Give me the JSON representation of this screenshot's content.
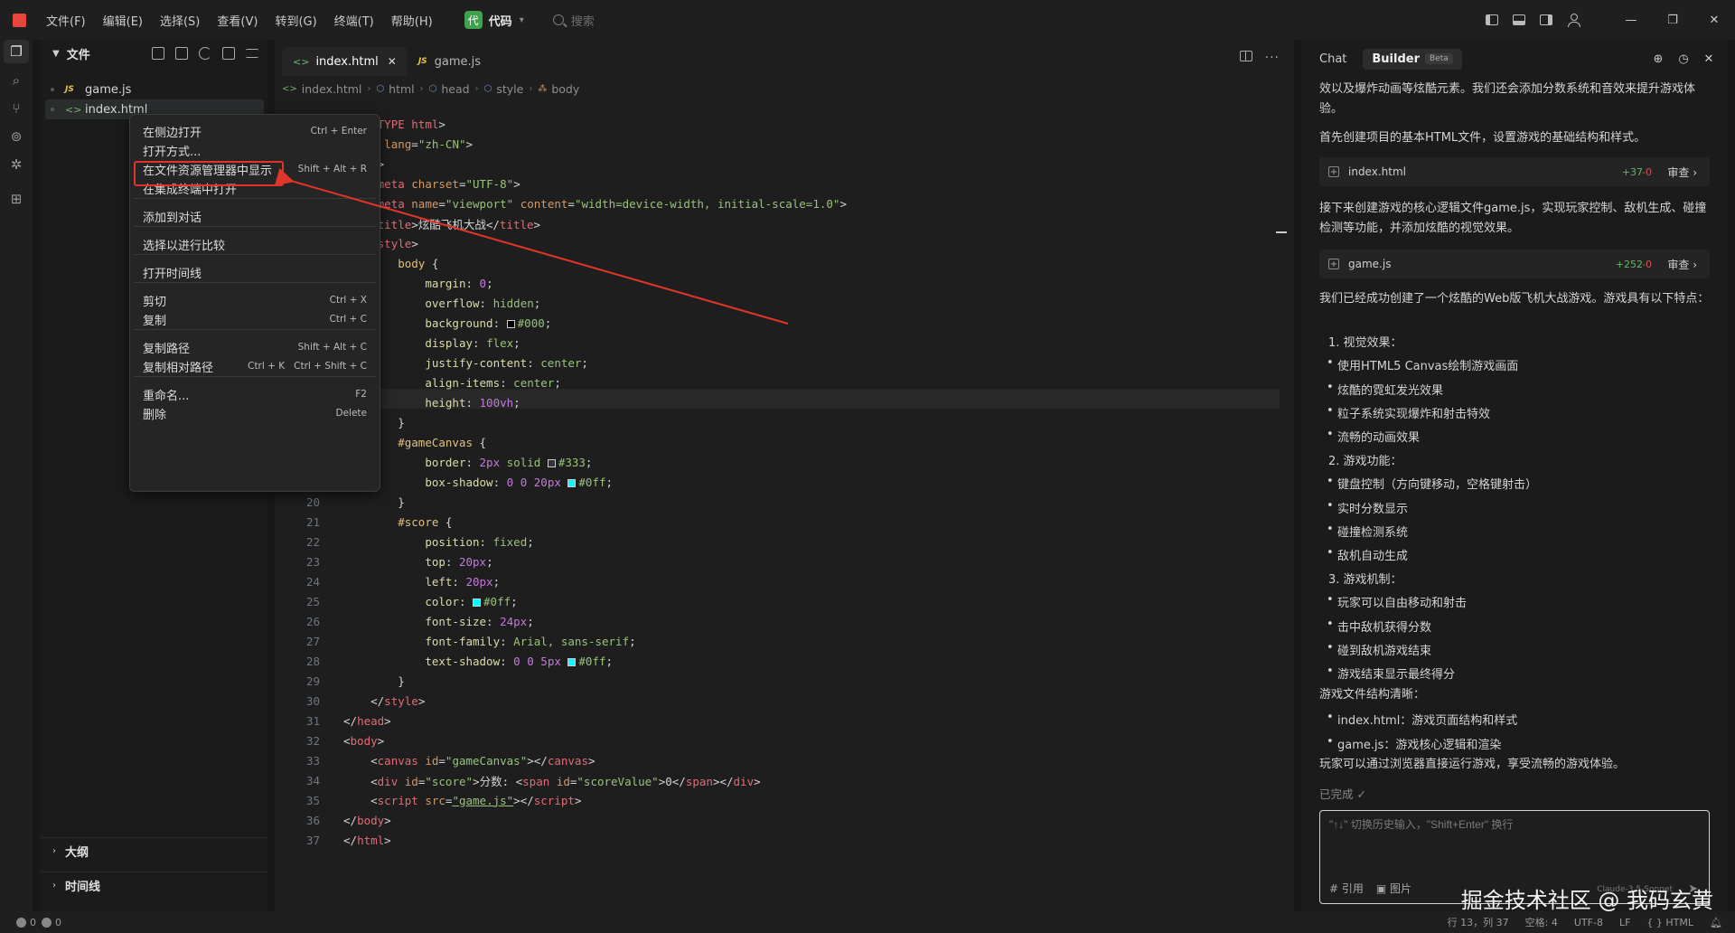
{
  "menu": [
    "文件(F)",
    "编辑(E)",
    "选择(S)",
    "查看(V)",
    "转到(G)",
    "终端(T)",
    "帮助(H)"
  ],
  "workspace": {
    "icon_label": "代",
    "name": "代码"
  },
  "search": {
    "placeholder": "搜索"
  },
  "explorer": {
    "title": "文件",
    "files": [
      {
        "badge": "JS",
        "name": "game.js"
      },
      {
        "badge": "<>",
        "name": "index.html"
      }
    ],
    "outline_label": "大纲",
    "timeline_label": "时间线"
  },
  "editor": {
    "tabs": [
      {
        "name": "index.html",
        "close": "✕"
      },
      {
        "name": "game.js"
      }
    ],
    "breadcrumb": [
      "index.html",
      "html",
      "head",
      "style",
      "body"
    ]
  },
  "context_menu": {
    "items": [
      {
        "label": "在侧边打开",
        "key": "Ctrl + Enter"
      },
      {
        "label": "打开方式...",
        "key": ""
      },
      {
        "label": "在文件资源管理器中显示",
        "key": "Shift + Alt + R"
      },
      {
        "label": "在集成终端中打开",
        "key": ""
      },
      {
        "label": "添加到对话",
        "key": ""
      },
      {
        "label": "选择以进行比较",
        "key": ""
      },
      {
        "label": "打开时间线",
        "key": ""
      },
      {
        "label": "剪切",
        "key": "Ctrl + X"
      },
      {
        "label": "复制",
        "key": "Ctrl + C"
      },
      {
        "label": "复制路径",
        "key": "Shift + Alt + C"
      },
      {
        "label": "复制相对路径",
        "key": "Ctrl + K   Ctrl + Shift + C"
      },
      {
        "label": "重命名...",
        "key": "F2"
      },
      {
        "label": "删除",
        "key": "Delete"
      }
    ]
  },
  "code_lines": [
    {
      "n": "",
      "html": "<span class='tk-punc'>&lt;!DOC</span><span class='tk-tag'>TYPE html</span><span class='tk-punc'>&gt;</span>"
    },
    {
      "n": "",
      "html": "<span class='tk-punc'>&lt;</span><span class='tk-tag'>html</span> <span class='tk-attr'>lang</span>=<span class='tk-str'>\"zh-CN\"</span><span class='tk-punc'>&gt;</span>"
    },
    {
      "n": "",
      "html": "<span class='tk-punc'>&lt;</span><span class='tk-tag'>head</span><span class='tk-punc'>&gt;</span>"
    },
    {
      "n": "",
      "html": "    <span class='tk-punc'>&lt;</span><span class='tk-tag'>meta</span> <span class='tk-attr'>charset</span>=<span class='tk-str'>\"UTF-8\"</span><span class='tk-punc'>&gt;</span>"
    },
    {
      "n": "",
      "html": "    <span class='tk-punc'>&lt;</span><span class='tk-tag'>meta</span> <span class='tk-attr'>name</span>=<span class='tk-str'>\"viewport\"</span> <span class='tk-attr'>content</span>=<span class='tk-str'>\"width=device-width, initial-scale=1.0\"</span><span class='tk-punc'>&gt;</span>"
    },
    {
      "n": "",
      "html": "    <span class='tk-punc'>&lt;</span><span class='tk-tag'>title</span><span class='tk-punc'>&gt;</span>炫酷飞机大战<span class='tk-punc'>&lt;/</span><span class='tk-tag'>title</span><span class='tk-punc'>&gt;</span>"
    },
    {
      "n": "",
      "html": "    <span class='tk-punc'>&lt;</span><span class='tk-tag'>style</span><span class='tk-punc'>&gt;</span>"
    },
    {
      "n": "",
      "html": "        <span class='tk-sel'>body</span> {"
    },
    {
      "n": "",
      "html": "            <span class='tk-prop'>margin</span>: <span class='tk-num'>0</span>;"
    },
    {
      "n": "",
      "html": "            <span class='tk-prop'>overflow</span>: <span class='tk-val'>hidden</span>;"
    },
    {
      "n": "",
      "html": "            <span class='tk-prop'>background</span>: <span class='swatch' style='background:#000'></span><span class='tk-val'>#000</span>;"
    },
    {
      "n": "",
      "html": "            <span class='tk-prop'>display</span>: <span class='tk-val'>flex</span>;"
    },
    {
      "n": "",
      "html": "            <span class='tk-prop'>justify-content</span>: <span class='tk-val'>center</span>;"
    },
    {
      "n": "",
      "html": "            <span class='tk-prop'>align-items</span>: <span class='tk-val'>center</span>;"
    },
    {
      "n": "",
      "html": "            <span class='tk-prop'>height</span>: <span class='tk-num'>100vh</span>;"
    },
    {
      "n": "",
      "html": "        }"
    },
    {
      "n": "",
      "html": "        <span class='tk-sel'>#gameCanvas</span> {"
    },
    {
      "n": "",
      "html": "            <span class='tk-prop'>border</span>: <span class='tk-num'>2px</span> <span class='tk-val'>solid</span> <span class='swatch' style='background:#333'></span><span class='tk-val'>#333</span>;"
    },
    {
      "n": "",
      "html": "            <span class='tk-prop'>box-shadow</span>: <span class='tk-num'>0</span> <span class='tk-num'>0</span> <span class='tk-num'>20px</span> <span class='swatch' style='background:#0ff'></span><span class='tk-val'>#0ff</span>;"
    },
    {
      "n": "20",
      "html": "        }"
    },
    {
      "n": "21",
      "html": "        <span class='tk-sel'>#score</span> {"
    },
    {
      "n": "22",
      "html": "            <span class='tk-prop'>position</span>: <span class='tk-val'>fixed</span>;"
    },
    {
      "n": "23",
      "html": "            <span class='tk-prop'>top</span>: <span class='tk-num'>20px</span>;"
    },
    {
      "n": "24",
      "html": "            <span class='tk-prop'>left</span>: <span class='tk-num'>20px</span>;"
    },
    {
      "n": "25",
      "html": "            <span class='tk-prop'>color</span>: <span class='swatch' style='background:#0ff'></span><span class='tk-val'>#0ff</span>;"
    },
    {
      "n": "26",
      "html": "            <span class='tk-prop'>font-size</span>: <span class='tk-num'>24px</span>;"
    },
    {
      "n": "27",
      "html": "            <span class='tk-prop'>font-family</span>: <span class='tk-val'>Arial, sans-serif</span>;"
    },
    {
      "n": "28",
      "html": "            <span class='tk-prop'>text-shadow</span>: <span class='tk-num'>0</span> <span class='tk-num'>0</span> <span class='tk-num'>5px</span> <span class='swatch' style='background:#0ff'></span><span class='tk-val'>#0ff</span>;"
    },
    {
      "n": "29",
      "html": "        }"
    },
    {
      "n": "30",
      "html": "    <span class='tk-punc'>&lt;/</span><span class='tk-tag'>style</span><span class='tk-punc'>&gt;</span>"
    },
    {
      "n": "31",
      "html": "<span class='tk-punc'>&lt;/</span><span class='tk-tag'>head</span><span class='tk-punc'>&gt;</span>"
    },
    {
      "n": "32",
      "html": "<span class='tk-punc'>&lt;</span><span class='tk-tag'>body</span><span class='tk-punc'>&gt;</span>"
    },
    {
      "n": "33",
      "html": "    <span class='tk-punc'>&lt;</span><span class='tk-tag'>canvas</span> <span class='tk-attr'>id</span>=<span class='tk-str'>\"gameCanvas\"</span><span class='tk-punc'>&gt;&lt;/</span><span class='tk-tag'>canvas</span><span class='tk-punc'>&gt;</span>"
    },
    {
      "n": "34",
      "html": "    <span class='tk-punc'>&lt;</span><span class='tk-tag'>div</span> <span class='tk-attr'>id</span>=<span class='tk-str'>\"score\"</span><span class='tk-punc'>&gt;</span>分数: <span class='tk-punc'>&lt;</span><span class='tk-tag'>span</span> <span class='tk-attr'>id</span>=<span class='tk-str'>\"scoreValue\"</span><span class='tk-punc'>&gt;</span>0<span class='tk-punc'>&lt;/</span><span class='tk-tag'>span</span><span class='tk-punc'>&gt;&lt;/</span><span class='tk-tag'>div</span><span class='tk-punc'>&gt;</span>"
    },
    {
      "n": "35",
      "html": "    <span class='tk-punc'>&lt;</span><span class='tk-tag'>script</span> <span class='tk-attr'>src</span>=<span class='tk-link'>\"game.js\"</span><span class='tk-punc'>&gt;&lt;/</span><span class='tk-tag'>script</span><span class='tk-punc'>&gt;</span>"
    },
    {
      "n": "36",
      "html": "<span class='tk-punc'>&lt;/</span><span class='tk-tag'>body</span><span class='tk-punc'>&gt;</span>"
    },
    {
      "n": "37",
      "html": "<span class='tk-punc'>&lt;/</span><span class='tk-tag'>html</span><span class='tk-punc'>&gt;</span>"
    }
  ],
  "chat": {
    "tab_chat": "Chat",
    "tab_builder": "Builder",
    "beta": "Beta",
    "intro": "效以及爆炸动画等炫酷元素。我们还会添加分数系统和音效来提升游戏体验。",
    "step1": "首先创建项目的基本HTML文件，设置游戏的基础结构和样式。",
    "card1": {
      "file": "index.html",
      "add": "+37",
      "del": "-0",
      "review": "审查"
    },
    "step2": "接下来创建游戏的核心逻辑文件game.js，实现玩家控制、敌机生成、碰撞检测等功能，并添加炫酷的视觉效果。",
    "card2": {
      "file": "game.js",
      "add": "+252",
      "del": "-0",
      "review": "审查"
    },
    "summary": "我们已经成功创建了一个炫酷的Web版飞机大战游戏。游戏具有以下特点：",
    "sec1": "1. 视觉效果：",
    "sec1_items": [
      "使用HTML5 Canvas绘制游戏画面",
      "炫酷的霓虹发光效果",
      "粒子系统实现爆炸和射击特效",
      "流畅的动画效果"
    ],
    "sec2": "2. 游戏功能：",
    "sec2_items": [
      "键盘控制（方向键移动，空格键射击）",
      "实时分数显示",
      "碰撞检测系统",
      "敌机自动生成"
    ],
    "sec3": "3. 游戏机制：",
    "sec3_items": [
      "玩家可以自由移动和射击",
      "击中敌机获得分数",
      "碰到敌机游戏结束",
      "游戏结束显示最终得分"
    ],
    "structure_title": "游戏文件结构清晰：",
    "structure_items": [
      "index.html：游戏页面结构和样式",
      "game.js：游戏核心逻辑和渲染"
    ],
    "closing": "玩家可以通过浏览器直接运行游戏，享受流畅的游戏体验。",
    "done": "已完成 ✓",
    "input_placeholder": "\"↑↓\" 切换历史输入，\"Shift+Enter\" 换行",
    "tool_ref": "# 引用",
    "tool_img": "图片",
    "model": "Claude-3.5-Sonnet"
  },
  "watermark": "掘金技术社区 @ 我码玄黄",
  "status": {
    "errors": "0",
    "warnings": "0",
    "position": "行 13，列 37",
    "spaces": "空格: 4",
    "encoding": "UTF-8",
    "eol": "LF",
    "language": "{ } HTML"
  },
  "colors": {
    "accent_red": "#e03528",
    "workspace_green": "#3fa34d"
  }
}
